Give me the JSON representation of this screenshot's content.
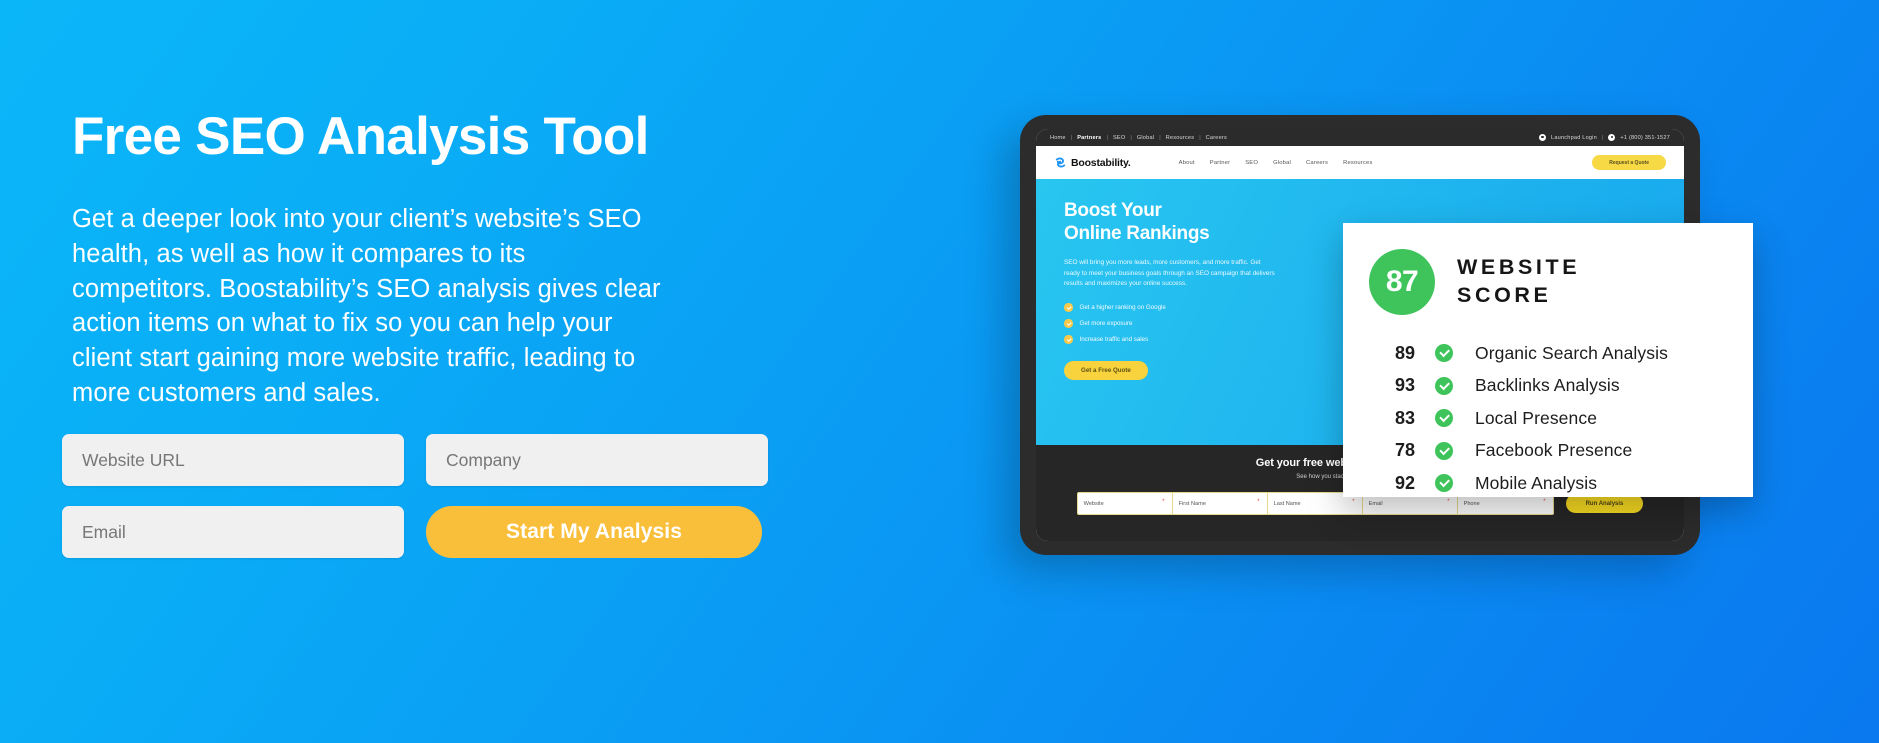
{
  "theme": {
    "bg_gradient_from": "#0bb6f8",
    "bg_gradient_to": "#0a78ef",
    "accent_yellow": "#f9bf3b",
    "accent_green": "#3fc45c"
  },
  "hero": {
    "title": "Free SEO Analysis Tool",
    "description": "Get a deeper look into your client’s website’s SEO health, as well as how it compares to its competitors. Boostability’s SEO analysis gives clear action items on what to fix so you can help your client start gaining more website traffic, leading to more customers and sales."
  },
  "form": {
    "website_placeholder": "Website URL",
    "website_value": "",
    "company_placeholder": "Company",
    "company_value": "",
    "email_placeholder": "Email",
    "email_value": "",
    "submit_label": "Start My Analysis"
  },
  "tablet": {
    "utility_bar": {
      "links": [
        "Home",
        "Partners",
        "SEO",
        "Global",
        "Resources",
        "Careers"
      ],
      "separator": "|",
      "login_label": "Launchpad Login",
      "phone": "+1 (800) 351-1527"
    },
    "nav": {
      "brand": "Boostability.",
      "links": [
        "About",
        "Partner",
        "SEO",
        "Global",
        "Careers",
        "Resources"
      ],
      "cta_label": "Request a Quote"
    },
    "hero": {
      "title_line1": "Boost Your",
      "title_line2": "Online Rankings",
      "paragraph": "SEO will bring you more leads, more customers, and more traffic. Get ready to meet your business goals through an SEO campaign that delivers results and maximizes your online success.",
      "bullets": [
        "Get a higher ranking on Google",
        "Get more exposure",
        "Increase traffic and sales"
      ],
      "cta_label": "Get a Free Quote"
    },
    "footer": {
      "heading": "Get your free website SEO analysis now.",
      "subheading": "See how you stack up against your competitors.",
      "fields": [
        "Website",
        "First Name",
        "Last Name",
        "Email",
        "Phone"
      ],
      "required_marker": "*",
      "button_label": "Run Analysis"
    }
  },
  "score_card": {
    "overall_score": "87",
    "title_line1": "WEBSITE",
    "title_line2": "SCORE",
    "rows": [
      {
        "score": "89",
        "label": "Organic Search Analysis"
      },
      {
        "score": "93",
        "label": "Backlinks Analysis"
      },
      {
        "score": "83",
        "label": "Local Presence"
      },
      {
        "score": "78",
        "label": "Facebook Presence"
      },
      {
        "score": "92",
        "label": "Mobile Analysis"
      }
    ]
  }
}
